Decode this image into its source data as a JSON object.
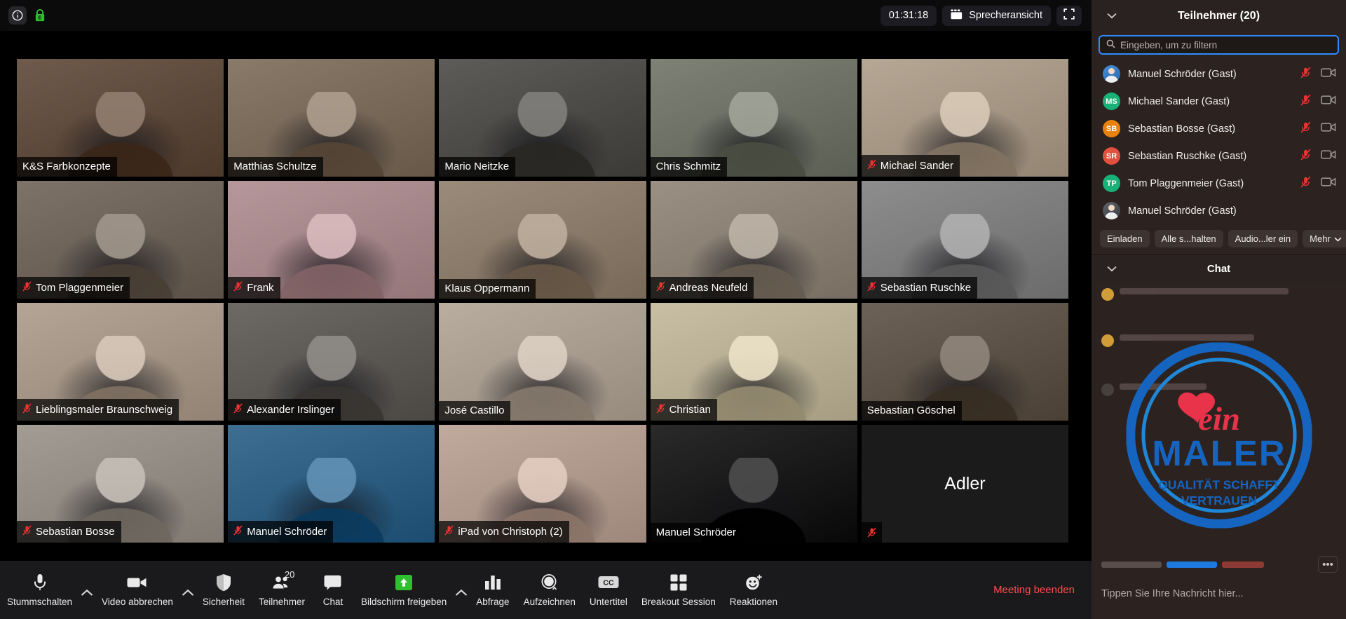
{
  "topbar": {
    "info_icon": "info-icon",
    "encryption_icon": "green-lock-icon",
    "timer": "01:31:18",
    "view_mode": "Sprecheransicht",
    "view_icon": "calendar-grid-icon",
    "fullscreen_icon": "fullscreen-icon"
  },
  "tiles": [
    {
      "name": "K&S Farbkonzepte",
      "muted": false,
      "video": true,
      "active": false,
      "bg": "#6f5b4c",
      "pose": "man-dark-jacket"
    },
    {
      "name": "Matthias Schultze",
      "muted": false,
      "video": true,
      "active": false,
      "bg": "#8a7a6a",
      "pose": "man-white-shirt"
    },
    {
      "name": "Mario Neitzke",
      "muted": false,
      "video": true,
      "active": false,
      "bg": "#5d5c58",
      "pose": "man-grey-beard"
    },
    {
      "name": "Chris Schmitz",
      "muted": false,
      "video": true,
      "active": false,
      "bg": "#7e8276",
      "pose": "man-dark-shirt"
    },
    {
      "name": "Michael Sander",
      "muted": true,
      "video": true,
      "active": false,
      "bg": "#b6a795",
      "pose": "man-beard"
    },
    {
      "name": "Tom Plaggenmeier",
      "muted": true,
      "video": true,
      "active": false,
      "bg": "#7d7369",
      "pose": "man-dark-top"
    },
    {
      "name": "Frank",
      "muted": true,
      "video": true,
      "active": false,
      "bg": "#b6979a",
      "pose": "man-red-shirt"
    },
    {
      "name": "Klaus Oppermann",
      "muted": false,
      "video": true,
      "active": false,
      "bg": "#9b8b7a",
      "pose": "man-office"
    },
    {
      "name": "Andreas Neufeld",
      "muted": true,
      "video": true,
      "active": false,
      "bg": "#9a9084",
      "pose": "man-bookshelf"
    },
    {
      "name": "Sebastian Ruschke",
      "muted": true,
      "video": true,
      "active": false,
      "bg": "#8d8d8d",
      "pose": "man-cap-blurred"
    },
    {
      "name": "Lieblingsmaler Braunschweig",
      "muted": true,
      "video": true,
      "active": false,
      "bg": "#b4a596",
      "pose": "man-suit"
    },
    {
      "name": "Alexander Irslinger",
      "muted": true,
      "video": true,
      "active": false,
      "bg": "#6d6a66",
      "pose": "man-beard-dark"
    },
    {
      "name": "José Castillo",
      "muted": false,
      "video": true,
      "active": false,
      "bg": "#b9ada0",
      "pose": "man-striped-shirt"
    },
    {
      "name": "Christian",
      "muted": true,
      "video": true,
      "active": false,
      "bg": "#c8bfa4",
      "pose": "man-white-tshirt"
    },
    {
      "name": "Sebastian Göschel",
      "muted": false,
      "video": true,
      "active": true,
      "bg": "#6c6257",
      "pose": "man-navy-tshirt"
    },
    {
      "name": "Sebastian Bosse",
      "muted": true,
      "video": true,
      "active": false,
      "bg": "#a39c94",
      "pose": "man-glasses"
    },
    {
      "name": "Manuel Schröder",
      "muted": true,
      "video": true,
      "active": false,
      "bg": "#3e6f93",
      "pose": "man-blue-bg"
    },
    {
      "name": "iPad von Christoph (2)",
      "muted": true,
      "video": true,
      "active": false,
      "bg": "#c0a99d",
      "pose": "man-glasses-bald"
    },
    {
      "name": "Manuel Schröder",
      "muted": false,
      "video": true,
      "active": false,
      "bg": "#2a2a2a",
      "pose": "man-with-baby"
    },
    {
      "name": "Adler",
      "muted": true,
      "video": false,
      "active": false,
      "bg": "#1b1b1b",
      "pose": "no-video"
    }
  ],
  "toolbar": {
    "items": [
      {
        "label": "Stummschalten",
        "icon": "microphone-icon",
        "caret": true,
        "badge": null
      },
      {
        "label": "Video abbrechen",
        "icon": "video-camera-icon",
        "caret": true,
        "badge": null
      },
      {
        "label": "Sicherheit",
        "icon": "shield-icon",
        "caret": false,
        "badge": null
      },
      {
        "label": "Teilnehmer",
        "icon": "participants-icon",
        "caret": false,
        "badge": "20"
      },
      {
        "label": "Chat",
        "icon": "chat-bubble-icon",
        "caret": false,
        "badge": null
      },
      {
        "label": "Bildschirm freigeben",
        "icon": "share-screen-icon",
        "caret": true,
        "badge": null
      },
      {
        "label": "Abfrage",
        "icon": "poll-bars-icon",
        "caret": false,
        "badge": null
      },
      {
        "label": "Aufzeichnen",
        "icon": "record-circle-icon",
        "caret": false,
        "badge": null
      },
      {
        "label": "Untertitel",
        "icon": "closed-caption-icon",
        "caret": false,
        "badge": null
      },
      {
        "label": "Breakout Session",
        "icon": "breakout-grid-icon",
        "caret": false,
        "badge": null
      },
      {
        "label": "Reaktionen",
        "icon": "reactions-smiley-icon",
        "caret": false,
        "badge": null
      }
    ],
    "end_meeting": "Meeting beenden"
  },
  "participants_panel": {
    "title": "Teilnehmer (20)",
    "collapse_icon": "chevron-down-icon",
    "search_placeholder": "Eingeben, um zu filtern",
    "search_value": "",
    "search_icon": "search-icon",
    "rows": [
      {
        "name": "Manuel Schröder (Gast)",
        "initials": "",
        "avatar_color": "#4a90d9",
        "photo": true,
        "muted": true,
        "video_off": true
      },
      {
        "name": "Michael Sander (Gast)",
        "initials": "MS",
        "avatar_color": "#18b277",
        "photo": false,
        "muted": true,
        "video_off": true
      },
      {
        "name": "Sebastian Bosse (Gast)",
        "initials": "SB",
        "avatar_color": "#e8820c",
        "photo": false,
        "muted": true,
        "video_off": true
      },
      {
        "name": "Sebastian Ruschke (Gast)",
        "initials": "SR",
        "avatar_color": "#e2513f",
        "photo": false,
        "muted": true,
        "video_off": true
      },
      {
        "name": "Tom Plaggenmeier (Gast)",
        "initials": "TP",
        "avatar_color": "#18b277",
        "photo": false,
        "muted": true,
        "video_off": true
      },
      {
        "name": "Manuel Schröder (Gast)",
        "initials": "",
        "avatar_color": "#60646a",
        "photo": true,
        "muted": false,
        "video_off": false
      }
    ],
    "actions": [
      {
        "label": "Einladen",
        "caret": false
      },
      {
        "label": "Alle s...halten",
        "caret": false
      },
      {
        "label": "Audio...ler ein",
        "caret": false
      },
      {
        "label": "Mehr",
        "caret": true
      }
    ]
  },
  "chat_panel": {
    "title": "Chat",
    "collapse_icon": "chevron-down-icon",
    "input_placeholder": "Tippen Sie Ihre Nachricht hier...",
    "more_icon": "ellipsis-icon",
    "watermark_text": "Dein Maler – Qualität schafft Vertrauen"
  },
  "colors": {
    "accent_blue": "#2d8cff",
    "active_speaker": "#9ce542",
    "end_meeting_red": "#ff4b4b",
    "share_green": "#2fbf2f",
    "panel_bg": "#2c2220"
  }
}
